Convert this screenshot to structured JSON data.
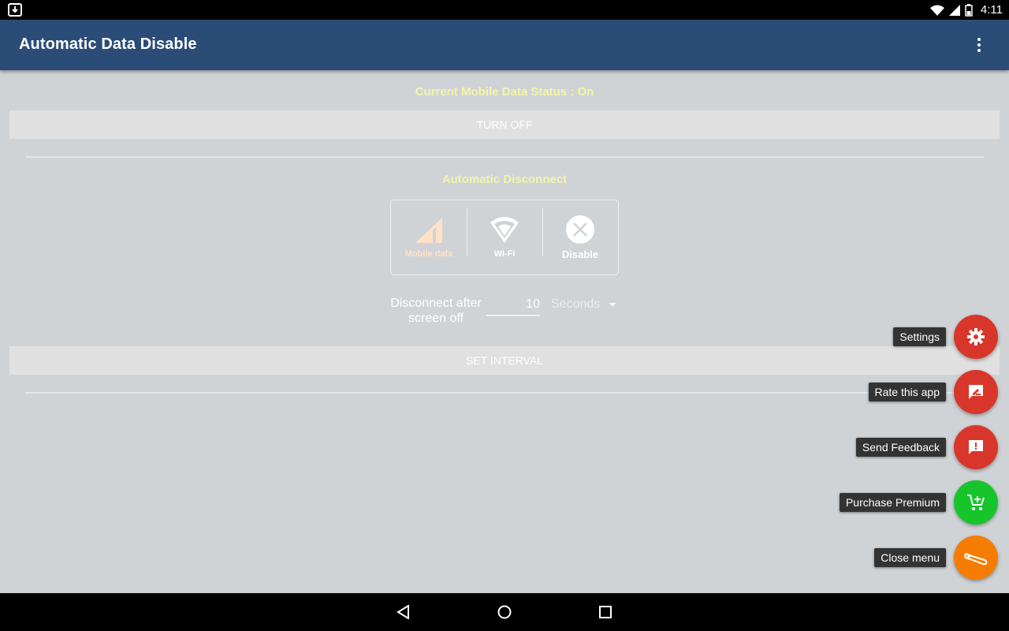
{
  "status_bar": {
    "time": "4:11"
  },
  "app_bar": {
    "title": "Automatic Data Disable"
  },
  "main": {
    "status_text": "Current Mobile Data Status : On",
    "turn_off_label": "TURN OFF",
    "auto_title": "Automatic Disconnect",
    "modes": [
      {
        "label": "Mobile data",
        "icon": "signal-icon"
      },
      {
        "label": "Wi-Fi",
        "icon": "wifi-icon"
      },
      {
        "label": "Disable",
        "icon": "close-circle-icon"
      }
    ],
    "interval_label": "Disconnect after screen off",
    "interval_value": "10",
    "interval_unit": "Seconds",
    "set_interval_label": "SET INTERVAL"
  },
  "fab_menu": [
    {
      "label": "Settings",
      "icon": "gear-icon",
      "color": "#d9362b"
    },
    {
      "label": "Rate this app",
      "icon": "rate-icon",
      "color": "#d9362b"
    },
    {
      "label": "Send Feedback",
      "icon": "feedback-icon",
      "color": "#d9362b"
    },
    {
      "label": "Purchase Premium",
      "icon": "cart-add-icon",
      "color": "#16c52a"
    },
    {
      "label": "Close menu",
      "icon": "wrench-icon",
      "color": "#f57c00"
    }
  ],
  "colors": {
    "app_bar": "#2b4c77",
    "background": "#cfd3d6",
    "status_text": "#f4f4a8"
  }
}
